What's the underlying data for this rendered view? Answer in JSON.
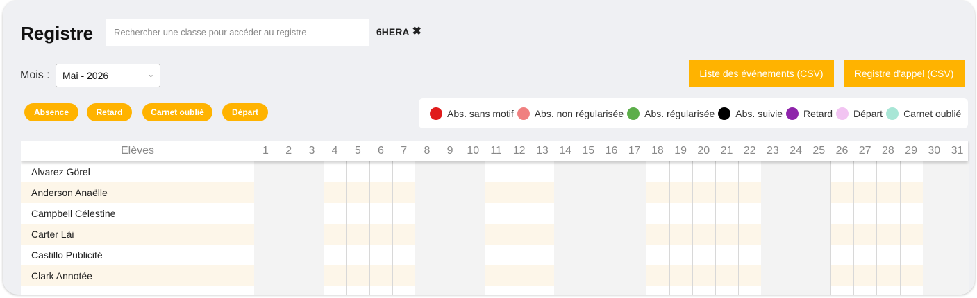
{
  "header": {
    "title": "Registre",
    "search_placeholder": "Rechercher une classe pour accéder au registre",
    "search_value": "",
    "class_tag": "6HERA",
    "class_close": "✖"
  },
  "month": {
    "label": "Mois :",
    "selected": "Mai - 2026",
    "chevron": "⌄"
  },
  "actions": {
    "events_csv": "Liste des événements (CSV)",
    "register_csv": "Registre d'appel (CSV)"
  },
  "pills": [
    "Absence",
    "Retard",
    "Carnet oublié",
    "Départ"
  ],
  "legend": [
    {
      "label": "Abs. sans motif",
      "color": "#e01b1b"
    },
    {
      "label": "Abs. non régularisée",
      "color": "#f08080"
    },
    {
      "label": "Abs. régularisée",
      "color": "#5cae4a"
    },
    {
      "label": "Abs. suivie",
      "color": "#000000"
    },
    {
      "label": "Retard",
      "color": "#8e24aa"
    },
    {
      "label": "Départ",
      "color": "#f2c4f2"
    },
    {
      "label": "Carnet oublié",
      "color": "#a8e6d6"
    }
  ],
  "grid": {
    "header_label": "Elèves",
    "days": [
      "1",
      "2",
      "3",
      "4",
      "5",
      "6",
      "7",
      "8",
      "9",
      "10",
      "11",
      "12",
      "13",
      "14",
      "15",
      "16",
      "17",
      "18",
      "19",
      "20",
      "21",
      "22",
      "23",
      "24",
      "25",
      "26",
      "27",
      "28",
      "29",
      "30",
      "31"
    ],
    "school_days": [
      4,
      5,
      6,
      7,
      11,
      12,
      13,
      18,
      19,
      20,
      21,
      22,
      26,
      27,
      28,
      29
    ],
    "students": [
      "Alvarez Görel",
      "Anderson Anaëlle",
      "Campbell Célestine",
      "Carter Lài",
      "Castillo Publicité",
      "Clark Annotée",
      ""
    ]
  },
  "colors": {
    "accent": "#ffb300",
    "row_odd": "#fdf6e9",
    "row_even": "#ffffff",
    "non_school": "#f3f3f3"
  }
}
